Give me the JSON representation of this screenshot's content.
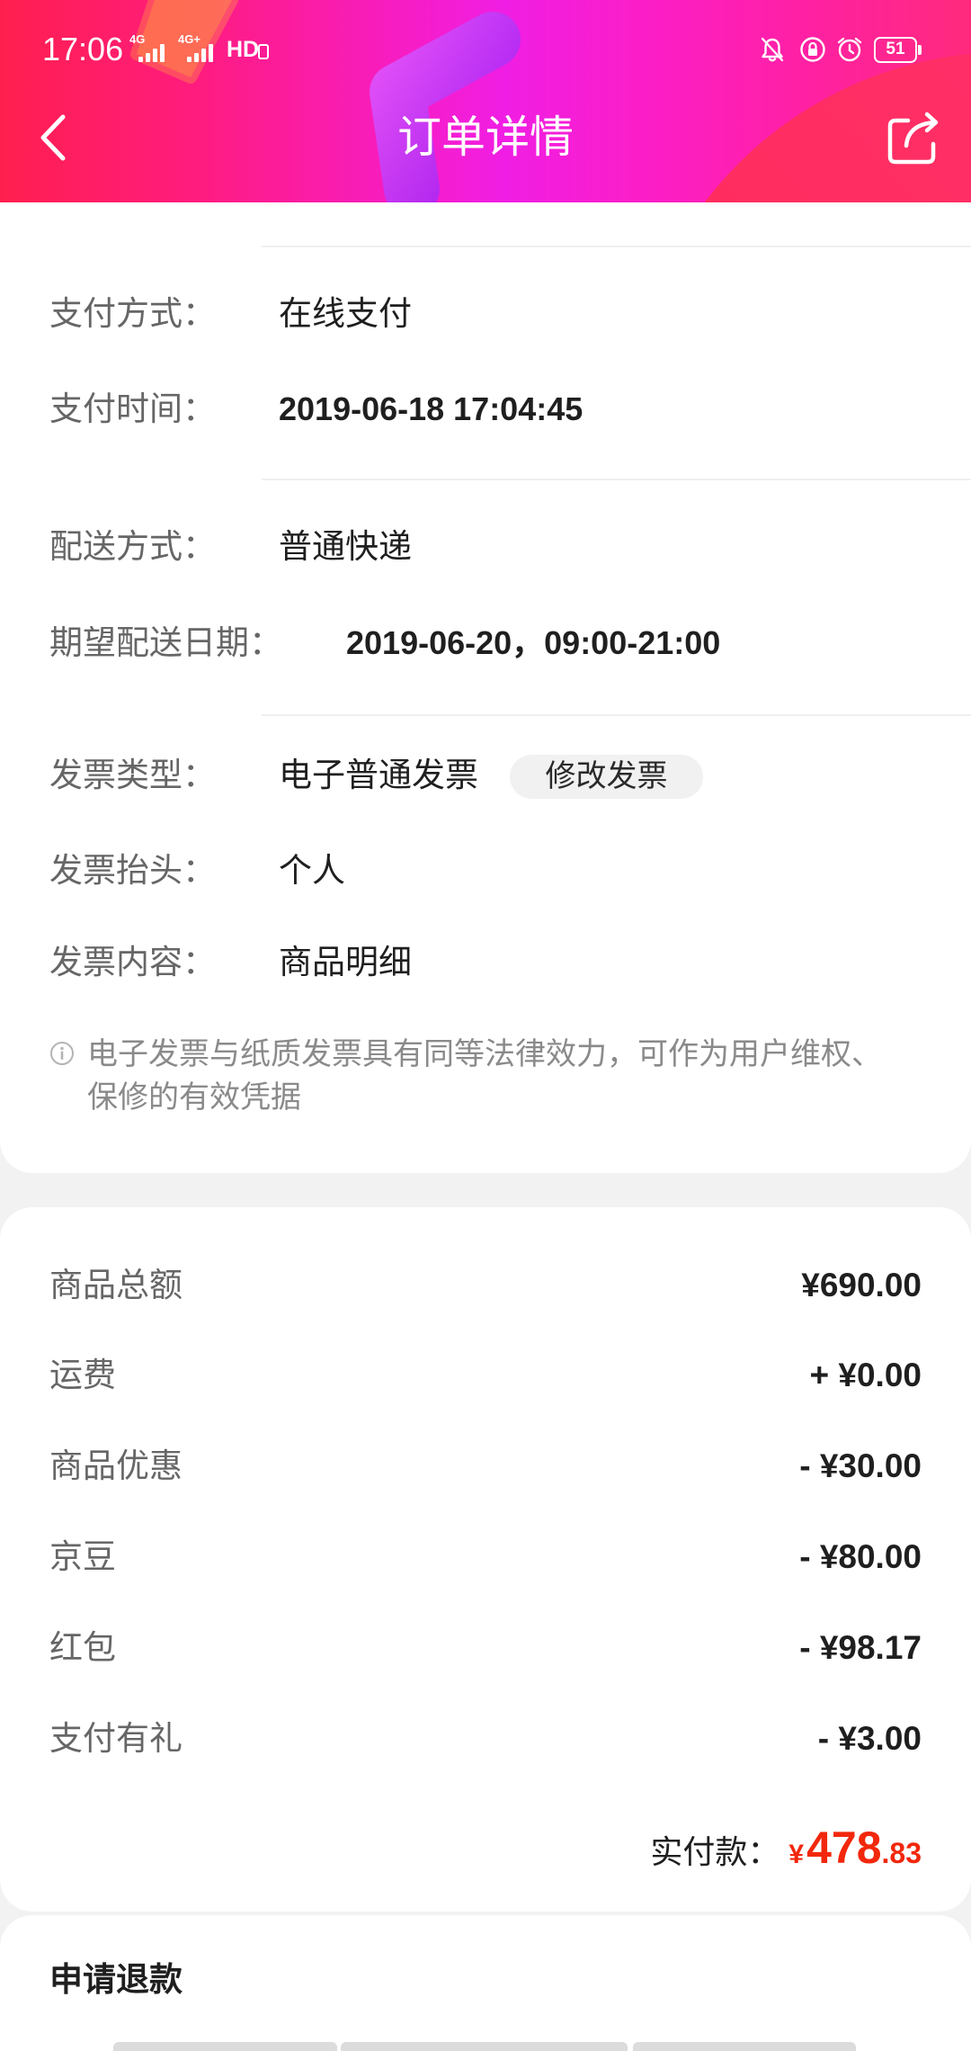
{
  "status_bar": {
    "time": "17:06",
    "network_primary": "4G",
    "network_secondary": "4G+",
    "hd": "HD",
    "battery": "51",
    "icons": [
      "signal-icon",
      "bell-off-icon",
      "rotation-lock-icon",
      "alarm-icon",
      "battery-icon"
    ]
  },
  "header": {
    "title": "订单详情",
    "back_icon": "chevron-left-icon",
    "share_icon": "share-icon"
  },
  "payment": {
    "method": {
      "label": "支付方式：",
      "value": "在线支付"
    },
    "time": {
      "label": "支付时间：",
      "value": "2019-06-18 17:04:45"
    }
  },
  "delivery": {
    "method": {
      "label": "配送方式：",
      "value": "普通快递"
    },
    "expected_date": {
      "label": "期望配送日期：",
      "value": "2019-06-20，09:00-21:00"
    }
  },
  "invoice": {
    "type": {
      "label": "发票类型：",
      "value": "电子普通发票"
    },
    "edit_button": "修改发票",
    "title": {
      "label": "发票抬头：",
      "value": "个人"
    },
    "content": {
      "label": "发票内容：",
      "value": "商品明细"
    },
    "note_icon": "info-icon",
    "note": "电子发票与纸质发票具有同等法律效力，可作为用户维权、保修的有效凭据"
  },
  "amounts": {
    "items": [
      {
        "label": "商品总额",
        "value": "¥690.00"
      },
      {
        "label": "运费",
        "value": "+ ¥0.00"
      },
      {
        "label": "商品优惠",
        "value": "- ¥30.00"
      },
      {
        "label": "京豆",
        "value": "- ¥80.00"
      },
      {
        "label": "红包",
        "value": "- ¥98.17"
      },
      {
        "label": "支付有礼",
        "value": "- ¥3.00"
      }
    ],
    "paid": {
      "label": "实付款：",
      "currency": "¥",
      "integer": "478",
      "decimal": ".83"
    }
  },
  "refund": {
    "title": "申请退款"
  },
  "colors": {
    "accent": "#f2270c",
    "header_left": "#ff1f4e",
    "header_center": "#f01ee4",
    "header_right": "#ff2a7c",
    "label": "#666666",
    "value": "#1f1f1f",
    "page_background": "#f2f2f2"
  }
}
